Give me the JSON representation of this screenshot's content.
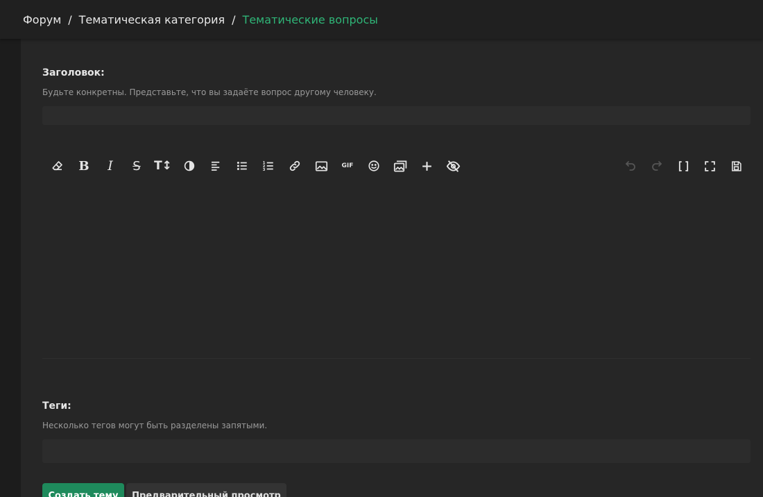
{
  "breadcrumb": {
    "items": [
      "Форум",
      "Тематическая категория"
    ],
    "separator": "/",
    "current": "Тематические вопросы"
  },
  "title_field": {
    "label": "Заголовок:",
    "hint": "Будьте конкретны. Представьте, что вы задаёте вопрос другому человеку.",
    "value": "",
    "placeholder": ""
  },
  "editor": {
    "toolbar_left": [
      "eraser-icon",
      "bold-icon",
      "italic-icon",
      "strikethrough-icon",
      "text-size-icon",
      "contrast-icon",
      "align-left-icon",
      "bullet-list-icon",
      "numbered-list-icon",
      "link-icon",
      "image-icon",
      "gif-icon",
      "emoji-icon",
      "gallery-icon",
      "plus-icon",
      "hide-icon"
    ],
    "toolbar_right": [
      "undo-icon",
      "redo-icon",
      "brackets-icon",
      "fullscreen-icon",
      "save-icon"
    ],
    "content": ""
  },
  "tags_field": {
    "label": "Теги:",
    "hint": "Несколько тегов могут быть разделены запятыми.",
    "value": "",
    "placeholder": ""
  },
  "actions": {
    "create_label": "Создать тему",
    "preview_label": "Предварительный просмотр"
  },
  "colors": {
    "accent": "#2fb577",
    "primary_button": "#1e8a5c",
    "panel": "#262626",
    "background": "#1e1e1e"
  }
}
